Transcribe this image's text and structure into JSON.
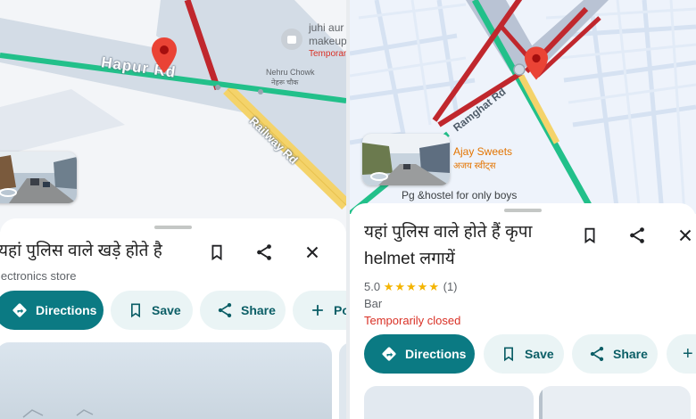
{
  "colors": {
    "accent": "#0b7a83",
    "accent_light": "#eaf4f5",
    "closed_red": "#d93025",
    "road_green": "#22c08a",
    "road_red": "#c0272d",
    "road_yellow": "#f4d36a",
    "map_bg": "#eef3fb",
    "pin_red": "#ea4335",
    "star_yellow": "#f4b400"
  },
  "left": {
    "map": {
      "road_labels": [
        "Hapur Rd",
        "Railway Rd"
      ],
      "poi_juhi": "juhi aur",
      "poi_juhi_sub": "makeup",
      "poi_juhi_status": "Temporar",
      "poi_nehru": "Nehru Chowk",
      "poi_nehru_hi": "नेहरू चौक",
      "streetview_icon": "rotate-360-icon",
      "pin_icon": "map-pin-icon"
    },
    "place": {
      "title": "यहां पुलिस वाले खड़े होते है",
      "category": "lectronics store"
    },
    "actions": {
      "directions": "Directions",
      "save": "Save",
      "share": "Share",
      "post": "Pos"
    }
  },
  "right": {
    "map": {
      "road_label": "Ramghat Rd",
      "poi_name": "Ajay Sweets",
      "poi_name_hi": "अजय स्वीट्स",
      "poi_bottom": "Pg &hostel for only boys",
      "streetview_icon": "rotate-360-icon",
      "pin_icon": "map-pin-icon"
    },
    "place": {
      "title": "यहां पुलिस वाले होते हैं कृपा helmet लगायें",
      "rating": "5.0",
      "stars": "★★★★★",
      "reviews": "(1)",
      "category": "Bar",
      "status": "Temporarily closed"
    },
    "actions": {
      "directions": "Directions",
      "save": "Save",
      "share": "Share",
      "add": "+"
    }
  }
}
